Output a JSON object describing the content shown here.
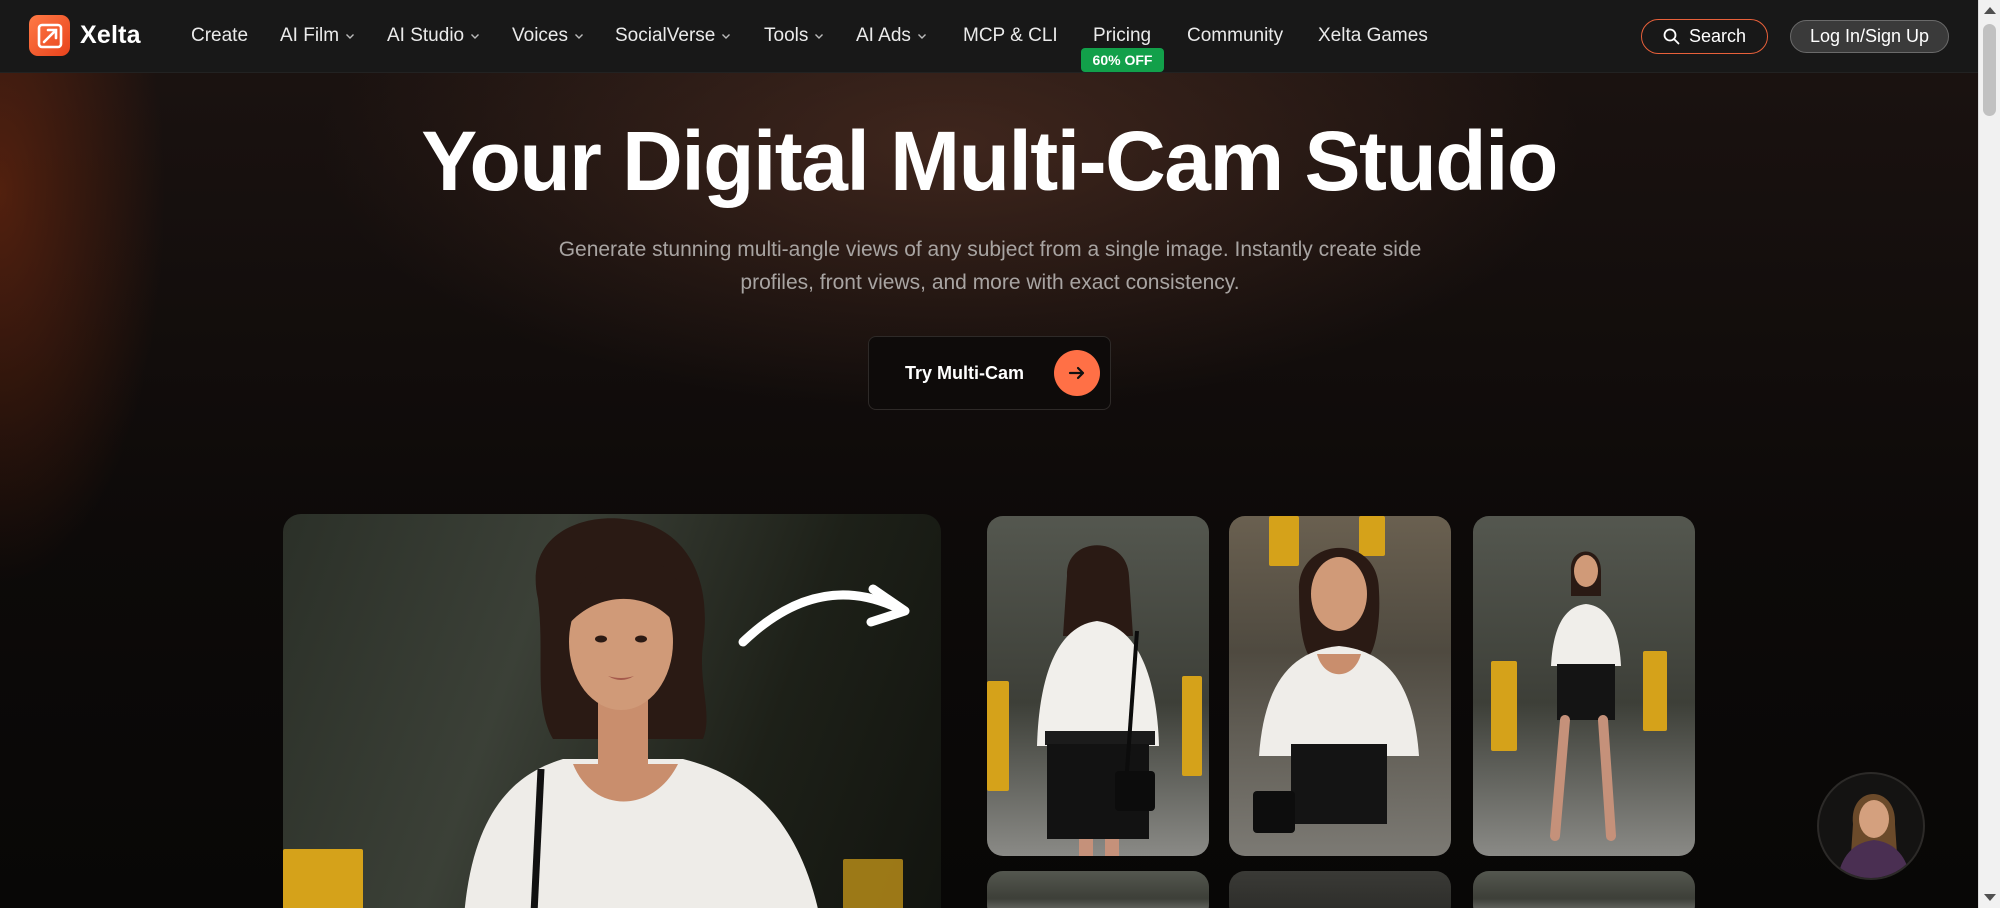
{
  "brand": {
    "name": "Xelta",
    "accent": "#ff7046"
  },
  "nav": {
    "items": [
      {
        "label": "Create",
        "dropdown": false
      },
      {
        "label": "AI Film",
        "dropdown": true
      },
      {
        "label": "AI Studio",
        "dropdown": true
      },
      {
        "label": "Voices",
        "dropdown": true
      },
      {
        "label": "SocialVerse",
        "dropdown": true
      },
      {
        "label": "Tools",
        "dropdown": true
      },
      {
        "label": "AI Ads",
        "dropdown": true
      },
      {
        "label": "MCP & CLI",
        "dropdown": false
      },
      {
        "label": "Pricing",
        "dropdown": false
      },
      {
        "label": "Community",
        "dropdown": false
      },
      {
        "label": "Xelta Games",
        "dropdown": false
      }
    ],
    "pricing_badge": "60% OFF",
    "search_label": "Search",
    "login_label": "Log In/Sign Up"
  },
  "hero": {
    "title": "Your Digital Multi-Cam Studio",
    "subtitle": "Generate stunning multi-angle views of any subject from a single image. Instantly create side profiles, front views, and more with exact consistency.",
    "cta_label": "Try Multi-Cam"
  },
  "gallery": {
    "source_image": "woman-front-portrait",
    "views": [
      "back-view",
      "front-view",
      "full-body-view",
      "view-4",
      "view-5",
      "view-6"
    ]
  }
}
